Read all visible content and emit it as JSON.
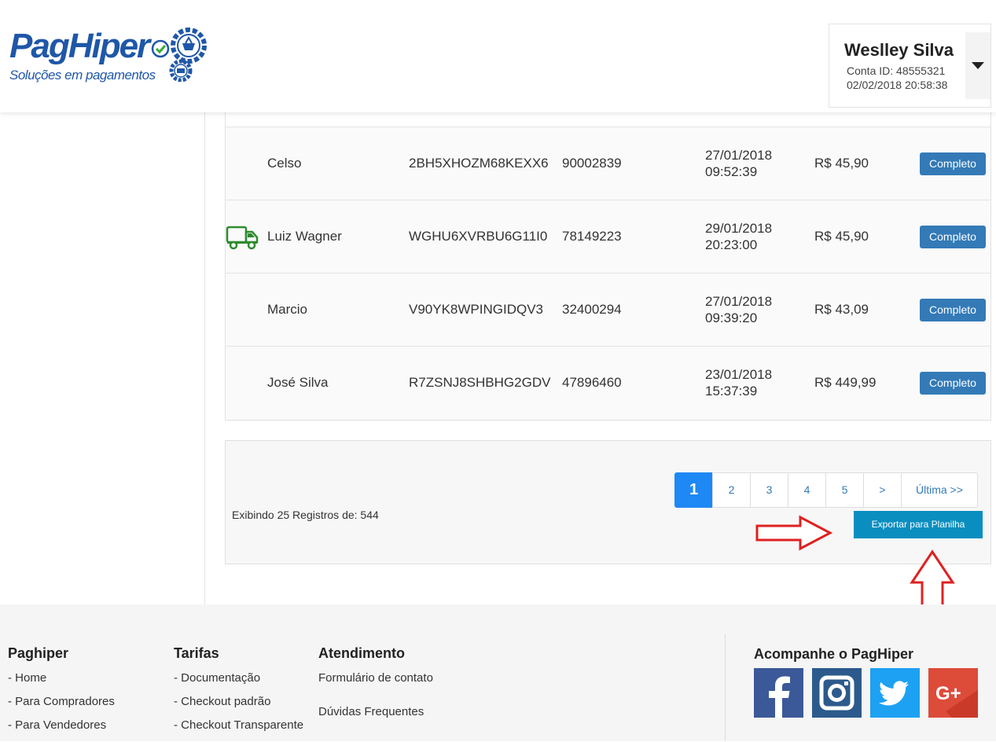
{
  "brand": {
    "name": "PagHiper",
    "tagline": "Soluções em pagamentos"
  },
  "user": {
    "name": "Weslley Silva",
    "account_id": "Conta ID: 48555321",
    "datetime": "02/02/2018 20:58:38"
  },
  "transactions": [
    {
      "name": "Celso",
      "code": "2BH5XHOZM68KEXX6",
      "number": "90002839",
      "date": "27/01/2018",
      "time": "09:52:39",
      "value": "R$ 45,90",
      "status": "Completo",
      "shipped": false
    },
    {
      "name": "Luiz Wagner",
      "code": "WGHU6XVRBU6G11I0",
      "number": "78149223",
      "date": "29/01/2018",
      "time": "20:23:00",
      "value": "R$ 45,90",
      "status": "Completo",
      "shipped": true
    },
    {
      "name": "Marcio",
      "code": "V90YK8WPINGIDQV3",
      "number": "32400294",
      "date": "27/01/2018",
      "time": "09:39:20",
      "value": "R$ 43,09",
      "status": "Completo",
      "shipped": false
    },
    {
      "name": "José Silva",
      "code": "R7ZSNJ8SHBHG2GDV",
      "number": "47896460",
      "date": "23/01/2018",
      "time": "15:37:39",
      "value": "R$ 449,99",
      "status": "Completo",
      "shipped": false
    }
  ],
  "pagination": {
    "records": "Exibindo 25 Registros de: 544",
    "pages": [
      "1",
      "2",
      "3",
      "4",
      "5",
      ">",
      "Última >>"
    ],
    "active": "1",
    "export_label": "Exportar para Planilha"
  },
  "footer": {
    "col1": {
      "title": "Paghiper",
      "links": [
        "- Home",
        "- Para Compradores",
        "- Para Vendedores"
      ]
    },
    "col2": {
      "title": "Tarifas",
      "links": [
        "- Documentação",
        "- Checkout padrão",
        "- Checkout Transparente"
      ]
    },
    "col3": {
      "title": "Atendimento",
      "links": [
        "Formulário de contato",
        "Dúvidas Frequentes"
      ]
    },
    "follow": "Acompanhe o PagHiper",
    "social": [
      {
        "name": "facebook",
        "color": "#3b5998"
      },
      {
        "name": "instagram",
        "color": "#2c5a8c"
      },
      {
        "name": "twitter",
        "color": "#1da1f2"
      },
      {
        "name": "google-plus",
        "color": "#dd4b39"
      }
    ]
  },
  "colors": {
    "primary": "#337ab7",
    "active_page": "#1e88f5",
    "export": "#0a8ec0",
    "annotation": "#e02020",
    "truck": "#2e8b2e"
  }
}
